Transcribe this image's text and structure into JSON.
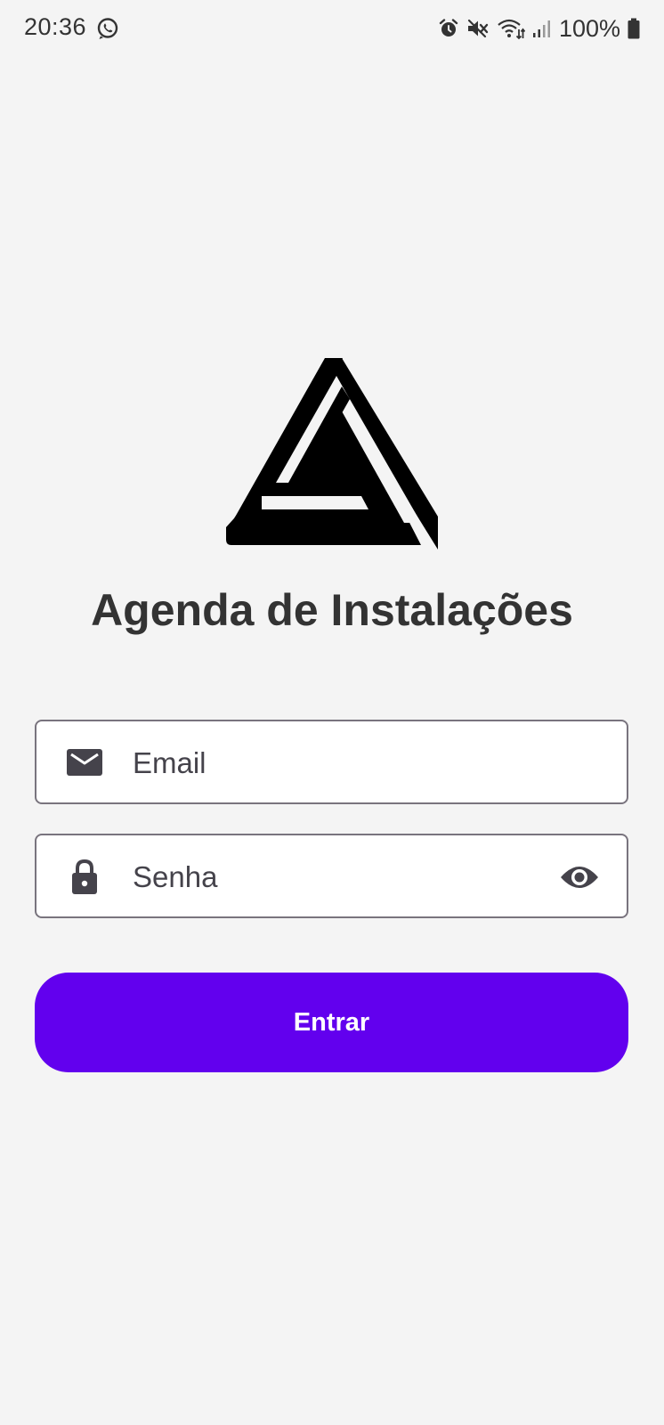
{
  "status_bar": {
    "time": "20:36",
    "battery": "100%",
    "icons": [
      "whatsapp-icon",
      "alarm-icon",
      "mute-icon",
      "wifi-icon",
      "signal-icon",
      "battery-icon"
    ]
  },
  "app": {
    "logo": "triangle-logo",
    "title": "Agenda de Instalações"
  },
  "form": {
    "email": {
      "placeholder": "Email",
      "value": "",
      "icon": "mail-icon"
    },
    "password": {
      "placeholder": "Senha",
      "value": "",
      "icon": "lock-icon",
      "toggle_icon": "eye-icon"
    },
    "submit_label": "Entrar"
  },
  "colors": {
    "background": "#f4f4f4",
    "primary": "#6200ee",
    "text": "#333333",
    "field_border": "#79747e"
  }
}
